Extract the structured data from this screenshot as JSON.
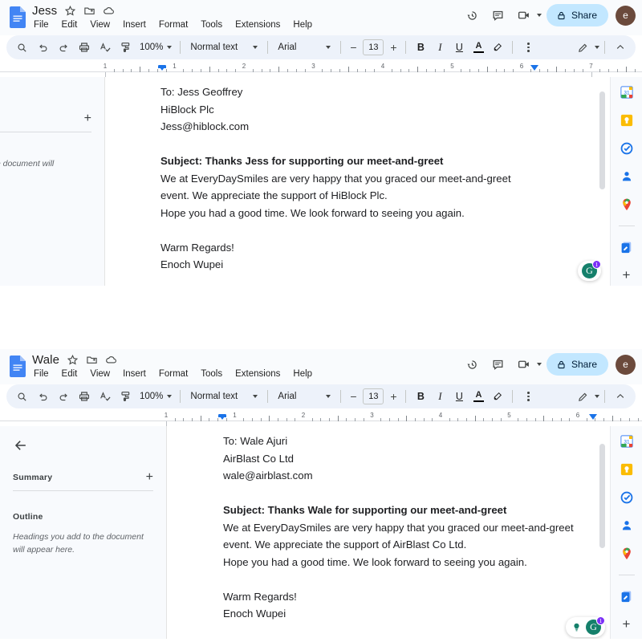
{
  "windows": [
    {
      "id": "jess",
      "header": {
        "doc_title": "Jess",
        "star_icon": "star-icon",
        "move_icon": "move-to-folder-icon",
        "cloud_icon": "saved-to-drive-icon",
        "menus": [
          "File",
          "Edit",
          "View",
          "Insert",
          "Format",
          "Tools",
          "Extensions",
          "Help"
        ],
        "history_icon": "version-history-icon",
        "comment_icon": "comment-history-icon",
        "meet_icon": "google-meet-icon",
        "share_label": "Share",
        "share_lock_icon": "lock-icon",
        "avatar_initial": "e",
        "share_bg": "#c2e7ff",
        "avatar_bg": "#6b4a3c"
      },
      "toolbar": {
        "search_icon": "search-icon",
        "undo_icon": "undo-icon",
        "redo_icon": "redo-icon",
        "print_icon": "print-icon",
        "spellcheck_icon": "spellcheck-icon",
        "paint_format_icon": "paint-format-icon",
        "zoom_value": "100%",
        "style_value": "Normal text",
        "font_value": "Arial",
        "font_size_value": "13",
        "decrease_label": "−",
        "increase_label": "+",
        "bold_label": "B",
        "italic_label": "I",
        "underline_label": "U",
        "text_color_label": "A",
        "text_color_value": "#000000",
        "highlight_icon": "highlight-color-icon",
        "more_icon": "more-options-icon",
        "editing_mode_icon": "editing-mode-pencil-icon",
        "collapse_icon": "hide-menus-chevron-up-icon"
      },
      "ruler": {
        "numbers": [
          "1",
          "1",
          "2",
          "3",
          "4",
          "5",
          "6",
          "7"
        ],
        "left_indent_in": 0.62,
        "right_indent_in": 6.38
      },
      "outline": {
        "visible_partial": true,
        "plus_label": "+",
        "hint_text": "add to the document will"
      },
      "document": {
        "lines": [
          {
            "text": "To: Jess Geoffrey",
            "style": "normal"
          },
          {
            "text": "HiBlock Plc",
            "style": "normal"
          },
          {
            "text": "Jess@hiblock.com",
            "style": "normal"
          },
          {
            "text": "",
            "style": "blank"
          },
          {
            "text": "Subject: Thanks Jess for supporting our meet-and-greet",
            "style": "subject"
          },
          {
            "text": "We at EveryDaySmiles are very happy that you graced our meet-and-greet",
            "style": "normal"
          },
          {
            "text": "event. We appreciate the support of HiBlock Plc.",
            "style": "normal"
          },
          {
            "text": "Hope you had a good time. We look forward to seeing you again.",
            "style": "normal"
          },
          {
            "text": "",
            "style": "blank"
          },
          {
            "text": "Warm Regards!",
            "style": "normal"
          },
          {
            "text": "Enoch Wupei",
            "style": "normal"
          }
        ]
      },
      "grammarly": {
        "show_bulb": false,
        "logo_label": "G",
        "badge_count": "1",
        "badge_color": "#7b2ff7",
        "logo_color": "#15806b"
      },
      "rail": {
        "icons": [
          "google-calendar-icon",
          "google-keep-icon",
          "google-tasks-icon",
          "google-contacts-icon",
          "google-maps-icon"
        ],
        "addon_icon": "docs-add-on-icon",
        "plus_label": "+"
      }
    },
    {
      "id": "wale",
      "header": {
        "doc_title": "Wale",
        "star_icon": "star-icon",
        "move_icon": "move-to-folder-icon",
        "cloud_icon": "saved-to-drive-icon",
        "menus": [
          "File",
          "Edit",
          "View",
          "Insert",
          "Format",
          "Tools",
          "Extensions",
          "Help"
        ],
        "history_icon": "version-history-icon",
        "comment_icon": "comment-history-icon",
        "meet_icon": "google-meet-icon",
        "share_label": "Share",
        "share_lock_icon": "lock-icon",
        "avatar_initial": "e",
        "share_bg": "#c2e7ff",
        "avatar_bg": "#6b4a3c"
      },
      "toolbar": {
        "search_icon": "search-icon",
        "undo_icon": "undo-icon",
        "redo_icon": "redo-icon",
        "print_icon": "print-icon",
        "spellcheck_icon": "spellcheck-icon",
        "paint_format_icon": "paint-format-icon",
        "zoom_value": "100%",
        "style_value": "Normal text",
        "font_value": "Arial",
        "font_size_value": "13",
        "decrease_label": "−",
        "increase_label": "+",
        "bold_label": "B",
        "italic_label": "I",
        "underline_label": "U",
        "text_color_label": "A",
        "text_color_value": "#000000",
        "highlight_icon": "highlight-color-icon",
        "more_icon": "more-options-icon",
        "editing_mode_icon": "editing-mode-pencil-icon",
        "collapse_icon": "hide-menus-chevron-up-icon"
      },
      "ruler": {
        "numbers": [
          "1",
          "1",
          "2",
          "3",
          "4",
          "5",
          "6"
        ],
        "left_indent_in": 0.62,
        "right_indent_in": 6.38
      },
      "outline": {
        "visible_partial": false,
        "back_icon": "back-arrow-icon",
        "summary_label": "Summary",
        "plus_label": "+",
        "outline_label": "Outline",
        "hint_text": "Headings you add to the document will appear here."
      },
      "document": {
        "lines": [
          {
            "text": "To: Wale Ajuri",
            "style": "normal"
          },
          {
            "text": "AirBlast Co Ltd",
            "style": "normal"
          },
          {
            "text": "wale@airblast.com",
            "style": "normal"
          },
          {
            "text": "",
            "style": "blank"
          },
          {
            "text": "Subject: Thanks Wale for supporting our meet-and-greet",
            "style": "subject"
          },
          {
            "text": "We at EveryDaySmiles are very happy that you graced our meet-and-greet",
            "style": "normal"
          },
          {
            "text": "event. We appreciate the support of AirBlast Co Ltd.",
            "style": "normal"
          },
          {
            "text": "Hope you had a good time. We look forward to seeing you again.",
            "style": "normal"
          },
          {
            "text": "",
            "style": "blank"
          },
          {
            "text": "Warm Regards!",
            "style": "normal"
          },
          {
            "text": "Enoch Wupei",
            "style": "normal"
          }
        ]
      },
      "grammarly": {
        "show_bulb": true,
        "bulb_icon": "grammarly-idea-bulb-icon",
        "logo_label": "G",
        "badge_count": "1",
        "badge_color": "#7b2ff7",
        "logo_color": "#15806b"
      },
      "rail": {
        "icons": [
          "google-calendar-icon",
          "google-keep-icon",
          "google-tasks-icon",
          "google-contacts-icon",
          "google-maps-icon"
        ],
        "addon_icon": "docs-add-on-icon",
        "plus_label": "+"
      }
    }
  ]
}
